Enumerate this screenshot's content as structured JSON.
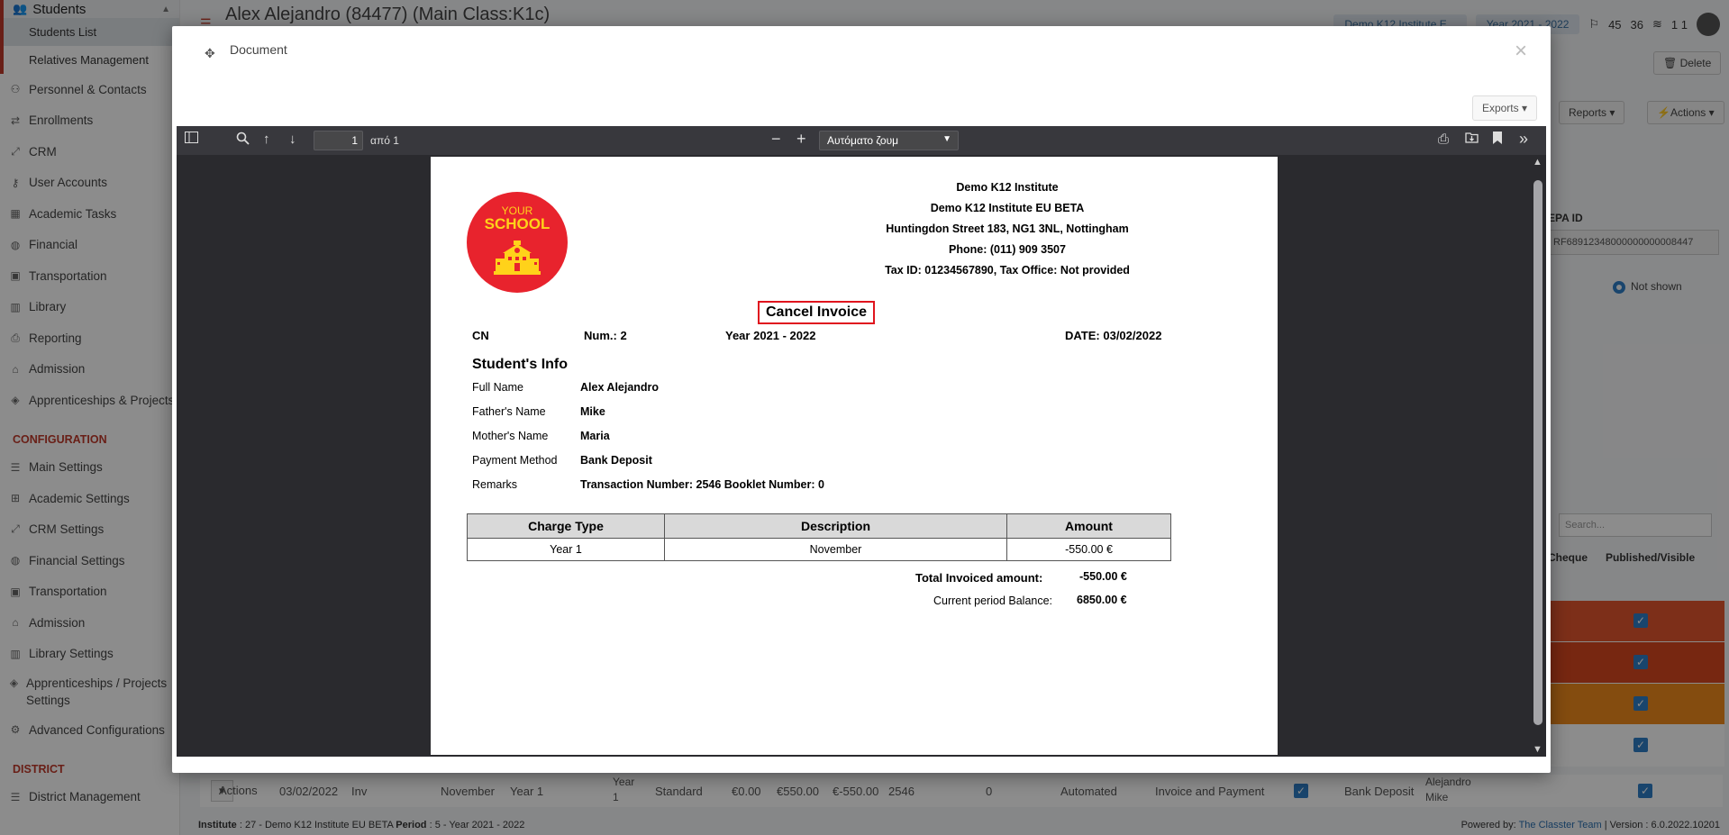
{
  "sidebar": {
    "top": "Students",
    "sub": [
      "Students List",
      "Relatives Management"
    ],
    "items": [
      "Personnel & Contacts",
      "Enrollments",
      "CRM",
      "User Accounts",
      "Academic Tasks",
      "Financial",
      "Transportation",
      "Library",
      "Reporting",
      "Admission",
      "Apprenticeships & Projects"
    ],
    "config_section": "CONFIGURATION",
    "config_items": [
      "Main Settings",
      "Academic Settings",
      "CRM Settings",
      "Financial Settings",
      "Transportation",
      "Admission",
      "Library Settings"
    ],
    "config_two_line": "Apprenticeships / Projects Settings",
    "config_last": "Advanced Configurations",
    "district_section": "DISTRICT",
    "district_items": [
      "District Management"
    ]
  },
  "header": {
    "title": "Alex Alejandro (84477) (Main Class:K1c)",
    "institute_pill": "Demo K12 Institute E...",
    "year_pill": "Year 2021 - 2022",
    "badge_1": "45",
    "badge_2": "36",
    "user_short": "1 1"
  },
  "background": {
    "delete": "Delete",
    "reports": "Reports",
    "actions": "Actions",
    "epa_label": "EPA ID",
    "epa_value": "RF68912348000000000008447",
    "not_shown": "Not shown",
    "search_placeholder": "Search...",
    "col_cheque": "Cheque",
    "col_published": "Published/Visible",
    "row": {
      "actions": "Actions",
      "date": "03/02/2022",
      "type": "Inv",
      "month": "November",
      "year": "Year 1",
      "year2": "Year 1",
      "standard": "Standard",
      "v1": "€0.00",
      "v2": "€550.00",
      "v3": "€-550.00",
      "num": "2546",
      "zero": "0",
      "auto": "Automated",
      "kind": "Invoice and Payment",
      "method": "Bank Deposit",
      "rel1": "Alejandro",
      "rel2": "Mike"
    },
    "footer_left_institute_label": "Institute",
    "footer_left_institute_value": ": 27 - Demo K12 Institute EU BETA",
    "footer_left_period_label": "Period",
    "footer_left_period_value": ": 5 - Year 2021 - 2022",
    "footer_powered": "Powered by:",
    "footer_team": "The Classter Team",
    "footer_version": "| Version : 6.0.2022.10201"
  },
  "modal": {
    "title": "Document",
    "close": "×",
    "exports": "Exports ▾"
  },
  "viewer": {
    "page_value": "1",
    "page_of": "από 1",
    "zoom": "Αυτόματο ζουμ"
  },
  "document": {
    "logo_top": "YOUR",
    "logo_main": "SCHOOL",
    "institute": [
      "Demo K12 Institute",
      "Demo K12 Institute EU BETA",
      "Huntingdon Street 183, NG1 3NL, Nottingham",
      "Phone: (011) 909 3507",
      "Tax ID: 01234567890, Tax Office: Not provided"
    ],
    "title": "Cancel Invoice",
    "cn": "CN",
    "num": "Num.: 2",
    "year": "Year 2021 - 2022",
    "date": "DATE: 03/02/2022",
    "section": "Student's Info",
    "info": [
      {
        "label": "Full Name",
        "value": "Alex Alejandro"
      },
      {
        "label": "Father's Name",
        "value": "Mike"
      },
      {
        "label": "Mother's Name",
        "value": "Maria"
      },
      {
        "label": "Payment Method",
        "value": "Bank Deposit"
      },
      {
        "label": "Remarks",
        "value": "Transaction Number: 2546 Booklet Number: 0"
      }
    ],
    "table_headers": [
      "Charge Type",
      "Description",
      "Amount"
    ],
    "table_rows": [
      [
        "Year 1",
        "November",
        "-550.00 €"
      ]
    ],
    "total_label": "Total Invoiced amount:",
    "total_value": "-550.00 €",
    "balance_label": "Current period Balance:",
    "balance_value": "6850.00 €"
  }
}
